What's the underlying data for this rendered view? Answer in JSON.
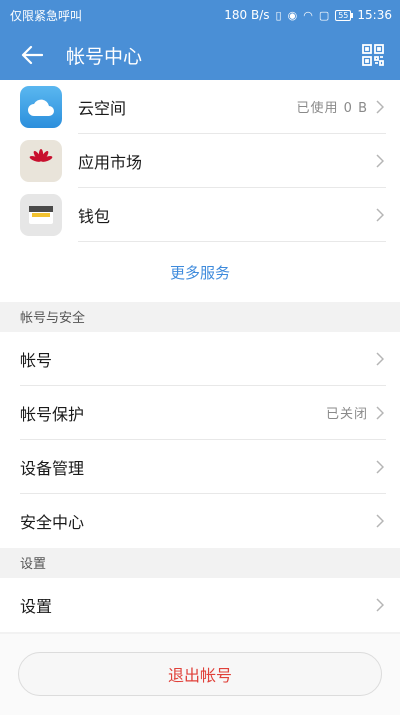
{
  "status": {
    "carrier": "仅限紧急呼叫",
    "speed": "180 B/s",
    "battery": "55",
    "time": "15:36"
  },
  "appbar": {
    "title": "帐号中心"
  },
  "services": [
    {
      "label": "云空间",
      "value": "已使用 0 B",
      "icon": "cloud-icon"
    },
    {
      "label": "应用市场",
      "value": "",
      "icon": "huawei-appgallery-icon"
    },
    {
      "label": "钱包",
      "value": "",
      "icon": "wallet-icon"
    }
  ],
  "more_services": "更多服务",
  "account_security": {
    "header": "帐号与安全",
    "items": [
      {
        "label": "帐号",
        "value": ""
      },
      {
        "label": "帐号保护",
        "value": "已关闭"
      },
      {
        "label": "设备管理",
        "value": ""
      },
      {
        "label": "安全中心",
        "value": ""
      }
    ]
  },
  "settings": {
    "header": "设置",
    "items": [
      {
        "label": "设置",
        "value": ""
      }
    ]
  },
  "logout": "退出帐号",
  "colors": {
    "accent": "#4a8fd6",
    "link": "#3f8bdc",
    "danger": "#e0413a"
  }
}
